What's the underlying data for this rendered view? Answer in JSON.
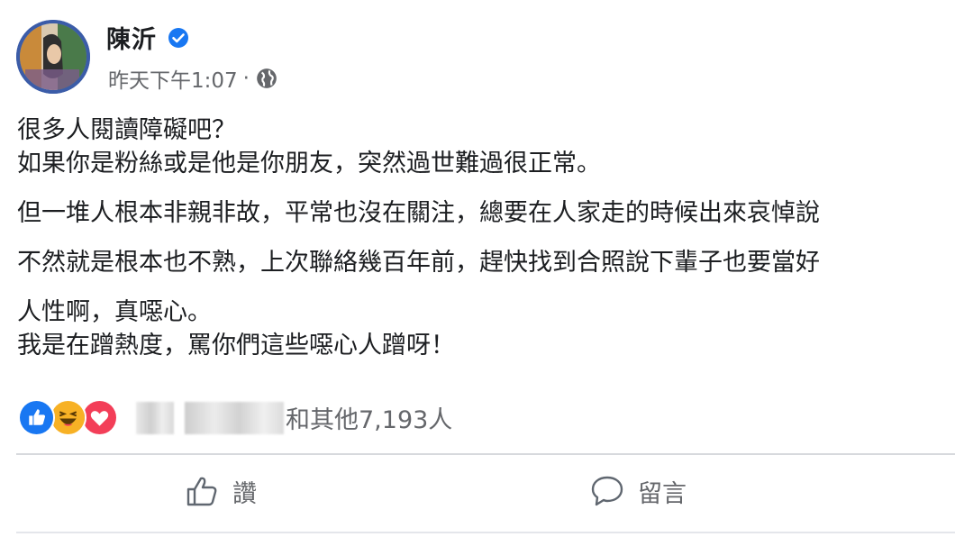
{
  "post": {
    "author": {
      "name": "陳沂",
      "verified_icon": "verified-badge-icon",
      "avatar_icon": "profile-avatar"
    },
    "timestamp": "昨天下午1:07",
    "separator": "·",
    "privacy_icon": "globe-icon",
    "paragraphs": [
      [
        "很多人閱讀障礙吧？",
        "如果你是粉絲或是他是你朋友，突然過世難過很正常。"
      ],
      [
        "但一堆人根本非親非故，平常也沒在關注，總要在人家走的時候出來哀悼說"
      ],
      [
        "不然就是根本也不熟，上次聯絡幾百年前，趕快找到合照說下輩子也要當好"
      ],
      [
        "人性啊，真噁心。",
        "我是在蹭熱度，罵你們這些噁心人蹭呀！"
      ]
    ]
  },
  "reactions": {
    "icons": [
      "like-reaction-icon",
      "haha-reaction-icon",
      "love-reaction-icon"
    ],
    "summary": "和其他7,193人"
  },
  "actions": {
    "like_label": "讚",
    "comment_label": "留言"
  },
  "colors": {
    "text": "#1c1e21",
    "secondary": "#65676b",
    "brand_blue": "#1877f2",
    "love_red": "#f33e58",
    "haha_yellow": "#f7b125"
  }
}
